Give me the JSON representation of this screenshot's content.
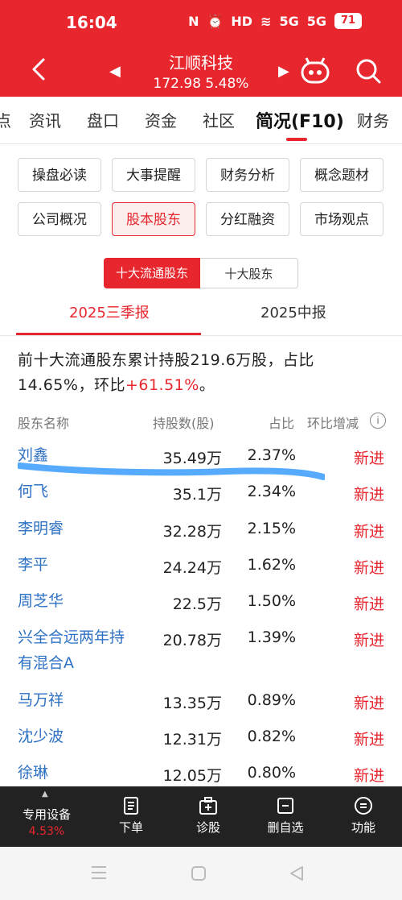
{
  "status_bar": {
    "time": "16:04",
    "battery": "71",
    "signal1": "5G",
    "signal2": "5G",
    "hd": "HD"
  },
  "header": {
    "stock_name": "江顺科技",
    "price_change": "172.98 5.48%"
  },
  "tabs": [
    "点",
    "资讯",
    "盘口",
    "资金",
    "社区",
    "简况(F10)",
    "财务"
  ],
  "grid_buttons": [
    [
      "操盘必读",
      "大事提醒",
      "财务分析",
      "概念题材"
    ],
    [
      "公司概况",
      "股本股东",
      "分红融资",
      "市场观点"
    ]
  ],
  "segment": {
    "selected": "十大流通股东",
    "other": "十大股东"
  },
  "periods": {
    "selected": "2025三季报",
    "other": "2025中报"
  },
  "summary": {
    "text": "前十大流通股东累计持股219.6万股，占比14.65%，环比",
    "change": "+61.51%",
    "end": "。"
  },
  "table": {
    "headers": [
      "股东名称",
      "持股数(股)",
      "占比",
      "环比增减"
    ],
    "rows": [
      {
        "name": "刘鑫",
        "shares": "35.49万",
        "pct": "2.37%",
        "change": "新进"
      },
      {
        "name": "何飞",
        "shares": "35.1万",
        "pct": "2.34%",
        "change": "新进"
      },
      {
        "name": "李明睿",
        "shares": "32.28万",
        "pct": "2.15%",
        "change": "新进"
      },
      {
        "name": "李平",
        "shares": "24.24万",
        "pct": "1.62%",
        "change": "新进"
      },
      {
        "name": "周芝华",
        "shares": "22.5万",
        "pct": "1.50%",
        "change": "新进"
      },
      {
        "name": "兴全合远两年持有混合A",
        "shares": "20.78万",
        "pct": "1.39%",
        "change": "新进"
      },
      {
        "name": "马万祥",
        "shares": "13.35万",
        "pct": "0.89%",
        "change": "新进"
      },
      {
        "name": "沈少波",
        "shares": "12.31万",
        "pct": "0.82%",
        "change": "新进"
      },
      {
        "name": "徐琳",
        "shares": "12.05万",
        "pct": "0.80%",
        "change": "新进"
      }
    ]
  },
  "toolbar": {
    "first": {
      "label": "专用设备",
      "pct": "4.53%"
    },
    "items": [
      "下单",
      "诊股",
      "删自选",
      "功能"
    ]
  },
  "colors": {
    "brand_red": "#e8262e",
    "link_blue": "#2f72c4",
    "toolbar_bg": "#222222"
  }
}
